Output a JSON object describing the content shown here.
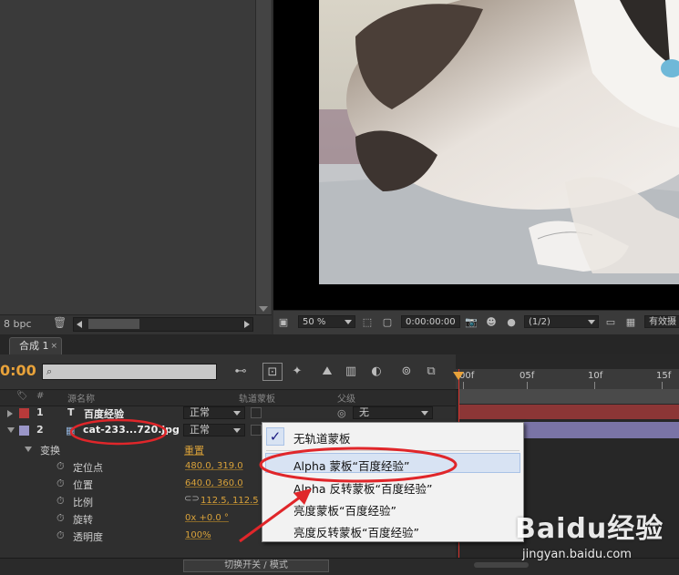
{
  "project": {
    "bpc": "8 bpc"
  },
  "viewer": {
    "zoom": "50 %",
    "timecode": "0:00:00:00",
    "resolution": "(1/2)",
    "view_label": "有效摄"
  },
  "timeline": {
    "tab_label": "合成 1",
    "tab_close": "×",
    "current_time": "0:00",
    "columns": {
      "num": "#",
      "source": "源名称",
      "track_matte": "轨道蒙板",
      "parent": "父级"
    },
    "ruler": [
      "00f",
      "05f",
      "10f",
      "15f"
    ],
    "layers": [
      {
        "num": "1",
        "type_icon": "T",
        "name": "百度经验",
        "mode": "正常",
        "parent": "无",
        "color": "#b83a3a"
      },
      {
        "num": "2",
        "name": "cat-233...720.jpg",
        "mode": "正常",
        "color": "#9a96c8"
      }
    ],
    "transform": {
      "label": "变换",
      "reset": "重置",
      "properties": [
        {
          "name": "定位点",
          "value": "480.0, 319.0"
        },
        {
          "name": "位置",
          "value": "640.0, 360.0"
        },
        {
          "name": "比例",
          "value": "112.5, 112.5"
        },
        {
          "name": "旋转",
          "value": "0x +0.0 °"
        },
        {
          "name": "透明度",
          "value": "100%"
        }
      ]
    },
    "toggle_label": "切换开关 / 模式"
  },
  "context_menu": {
    "items": [
      {
        "label": "无轨道蒙板",
        "checked": true
      },
      {
        "label": "Alpha 蒙板“百度经验”",
        "highlighted": true
      },
      {
        "label": "Alpha 反转蒙板“百度经验”"
      },
      {
        "label": "亮度蒙板“百度经验”"
      },
      {
        "label": "亮度反转蒙板“百度经验”"
      }
    ]
  },
  "watermark": {
    "brand": "Baidu经验",
    "url": "jingyan.baidu.com"
  },
  "colors": {
    "accent": "#e8a23a",
    "annotation": "#e0262a",
    "playhead": "#d8342e"
  }
}
